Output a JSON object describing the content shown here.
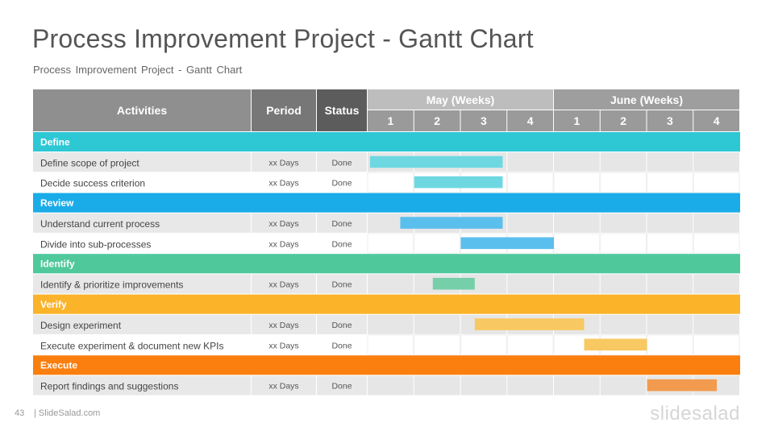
{
  "slide": {
    "title": "Process Improvement Project - Gantt Chart",
    "subtitle": "Process Improvement Project - Gantt Chart",
    "page_number": "43",
    "site": "| SlideSalad.com",
    "logo": "slidesalad"
  },
  "chart_data": {
    "type": "table",
    "headers": {
      "activities": "Activities",
      "period": "Period",
      "status": "Status",
      "months": [
        "May (Weeks)",
        "June (Weeks)"
      ],
      "weeks": [
        "1",
        "2",
        "3",
        "4",
        "1",
        "2",
        "3",
        "4"
      ]
    },
    "phases": [
      {
        "name": "Define",
        "color": "#2ec7d4",
        "bar_color": "#6dd8e2",
        "tasks": [
          {
            "name": "Define scope of project",
            "period": "xx Days",
            "status": "Done",
            "start_week": 1.05,
            "end_week": 3.9
          },
          {
            "name": "Decide success criterion",
            "period": "xx Days",
            "status": "Done",
            "start_week": 2.0,
            "end_week": 3.9
          }
        ]
      },
      {
        "name": "Review",
        "color": "#1aace9",
        "bar_color": "#5bbfee",
        "tasks": [
          {
            "name": "Understand current process",
            "period": "xx Days",
            "status": "Done",
            "start_week": 1.7,
            "end_week": 3.9
          },
          {
            "name": "Divide into sub-processes",
            "period": "xx Days",
            "status": "Done",
            "start_week": 3.0,
            "end_week": 5.0
          }
        ]
      },
      {
        "name": "Identify",
        "color": "#4fc89c",
        "bar_color": "#75cfa9",
        "tasks": [
          {
            "name": "Identify & prioritize improvements",
            "period": "xx Days",
            "status": "Done",
            "start_week": 2.4,
            "end_week": 3.3
          }
        ]
      },
      {
        "name": "Verify",
        "color": "#fbb32a",
        "bar_color": "#f8c862",
        "tasks": [
          {
            "name": "Design experiment",
            "period": "xx Days",
            "status": "Done",
            "start_week": 3.3,
            "end_week": 5.65
          },
          {
            "name": "Execute experiment & document new KPIs",
            "period": "xx Days",
            "status": "Done",
            "start_week": 5.65,
            "end_week": 7.0
          }
        ]
      },
      {
        "name": "Execute",
        "color": "#fb7f0f",
        "bar_color": "#f29b4f",
        "tasks": [
          {
            "name": "Report findings and suggestions",
            "period": "xx Days",
            "status": "Done",
            "start_week": 7.0,
            "end_week": 8.5
          }
        ]
      }
    ]
  }
}
